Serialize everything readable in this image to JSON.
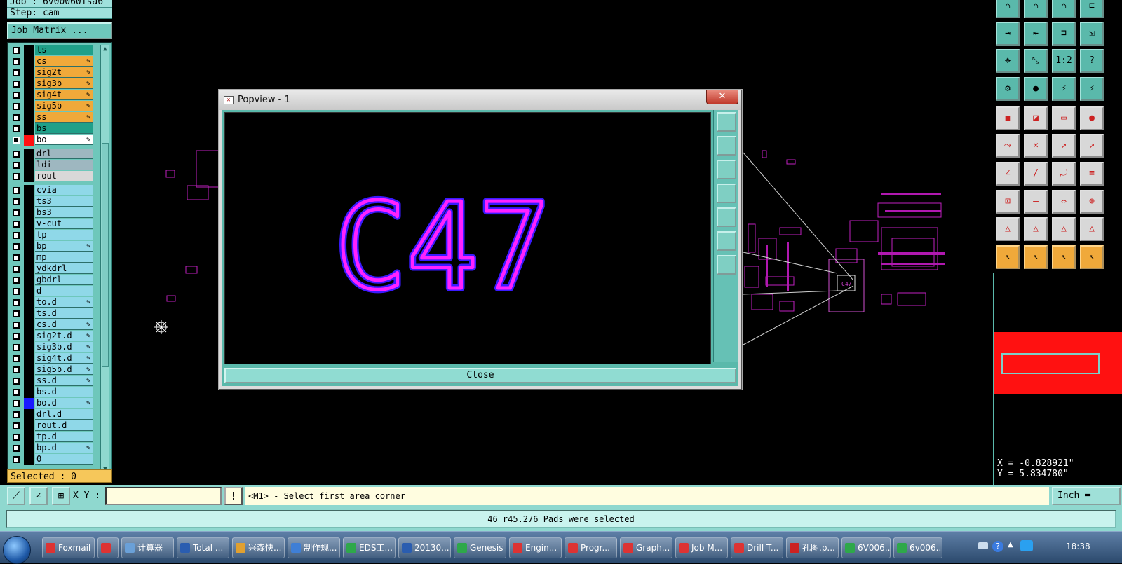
{
  "header": {
    "job": "Job : 6v00060isa6",
    "step": "Step: cam",
    "job_matrix": "Job Matrix ..."
  },
  "layers": [
    {
      "name": "ts",
      "bg": "#1fa089",
      "swatch": "#000",
      "pen": false
    },
    {
      "name": "cs",
      "bg": "#f0a93a",
      "swatch": "#000",
      "pen": true
    },
    {
      "name": "sig2t",
      "bg": "#f0a93a",
      "swatch": "#000",
      "pen": true
    },
    {
      "name": "sig3b",
      "bg": "#f0a93a",
      "swatch": "#000",
      "pen": true
    },
    {
      "name": "sig4t",
      "bg": "#f0a93a",
      "swatch": "#000",
      "pen": true
    },
    {
      "name": "sig5b",
      "bg": "#f0a93a",
      "swatch": "#000",
      "pen": true
    },
    {
      "name": "ss",
      "bg": "#f0a93a",
      "swatch": "#000",
      "pen": true
    },
    {
      "name": "bs",
      "bg": "#1fa089",
      "swatch": "#000",
      "pen": false
    },
    {
      "name": "bo",
      "bg": "#ffffff",
      "swatch": "#ff1111",
      "pen": true,
      "active": true
    }
  ],
  "layers_drill": [
    {
      "name": "drl",
      "bg": "#9eb7c0",
      "swatch": "#000",
      "pen": false
    },
    {
      "name": "ldi",
      "bg": "#9eb7c0",
      "swatch": "#000",
      "pen": false
    },
    {
      "name": "rout",
      "bg": "#d8d8d8",
      "swatch": "#000",
      "pen": false
    }
  ],
  "layers_misc": [
    {
      "name": "cvia",
      "pen": false
    },
    {
      "name": "ts3",
      "pen": false
    },
    {
      "name": "bs3",
      "pen": false
    },
    {
      "name": "v-cut",
      "pen": false
    },
    {
      "name": "tp",
      "pen": false
    },
    {
      "name": "bp",
      "pen": true
    },
    {
      "name": "mp",
      "pen": false
    },
    {
      "name": "ydkdrl",
      "pen": false
    },
    {
      "name": "gbdrl",
      "pen": false
    },
    {
      "name": "d",
      "pen": false
    },
    {
      "name": "to.d",
      "pen": true
    },
    {
      "name": "ts.d",
      "pen": false
    },
    {
      "name": "cs.d",
      "pen": true
    },
    {
      "name": "sig2t.d",
      "pen": true
    },
    {
      "name": "sig3b.d",
      "pen": true
    },
    {
      "name": "sig4t.d",
      "pen": true
    },
    {
      "name": "sig5b.d",
      "pen": true
    },
    {
      "name": "ss.d",
      "pen": true
    },
    {
      "name": "bs.d",
      "pen": false
    },
    {
      "name": "bo.d",
      "pen": true,
      "swatch": "#1a1aff"
    },
    {
      "name": "drl.d",
      "pen": false
    },
    {
      "name": "rout.d",
      "pen": false
    },
    {
      "name": "tp.d",
      "pen": false
    },
    {
      "name": "bp.d",
      "pen": true
    },
    {
      "name": "0",
      "pen": false
    }
  ],
  "selected_label": "Selected : 0",
  "popview": {
    "title": "Popview - 1",
    "text": "C47",
    "close_label": "Close"
  },
  "coords": {
    "x": "X = -0.828921\"",
    "y": "Y = 5.834780\""
  },
  "cmd": {
    "xy_label": "X Y :",
    "xy_value": "",
    "prompt": "<M1> - Select first area corner",
    "unit": "Inch"
  },
  "status": "46 r45.276 Pads were selected",
  "taskbar": {
    "items": [
      {
        "label": "Foxmail",
        "color": "#d33"
      },
      {
        "label": "",
        "color": "#d33"
      },
      {
        "label": "计算器",
        "color": "#6aa0d8"
      },
      {
        "label": "Total ...",
        "color": "#2a5db0"
      },
      {
        "label": "兴森快...",
        "color": "#e0a030"
      },
      {
        "label": "制作规...",
        "color": "#3f7fd6"
      },
      {
        "label": "EDS工...",
        "color": "#2ea84a"
      },
      {
        "label": "20130...",
        "color": "#2a5db0"
      },
      {
        "label": "Genesis",
        "color": "#2ea84a"
      },
      {
        "label": "Engin...",
        "color": "#d33"
      },
      {
        "label": "Progr...",
        "color": "#d33"
      },
      {
        "label": "Graph...",
        "color": "#d33"
      },
      {
        "label": "Job M...",
        "color": "#d33"
      },
      {
        "label": "Drill T...",
        "color": "#d33"
      },
      {
        "label": "孔图.p...",
        "color": "#c22"
      },
      {
        "label": "6V006...",
        "color": "#2ea84a"
      },
      {
        "label": "6v006...",
        "color": "#2ea84a"
      }
    ],
    "clock": "18:38"
  }
}
